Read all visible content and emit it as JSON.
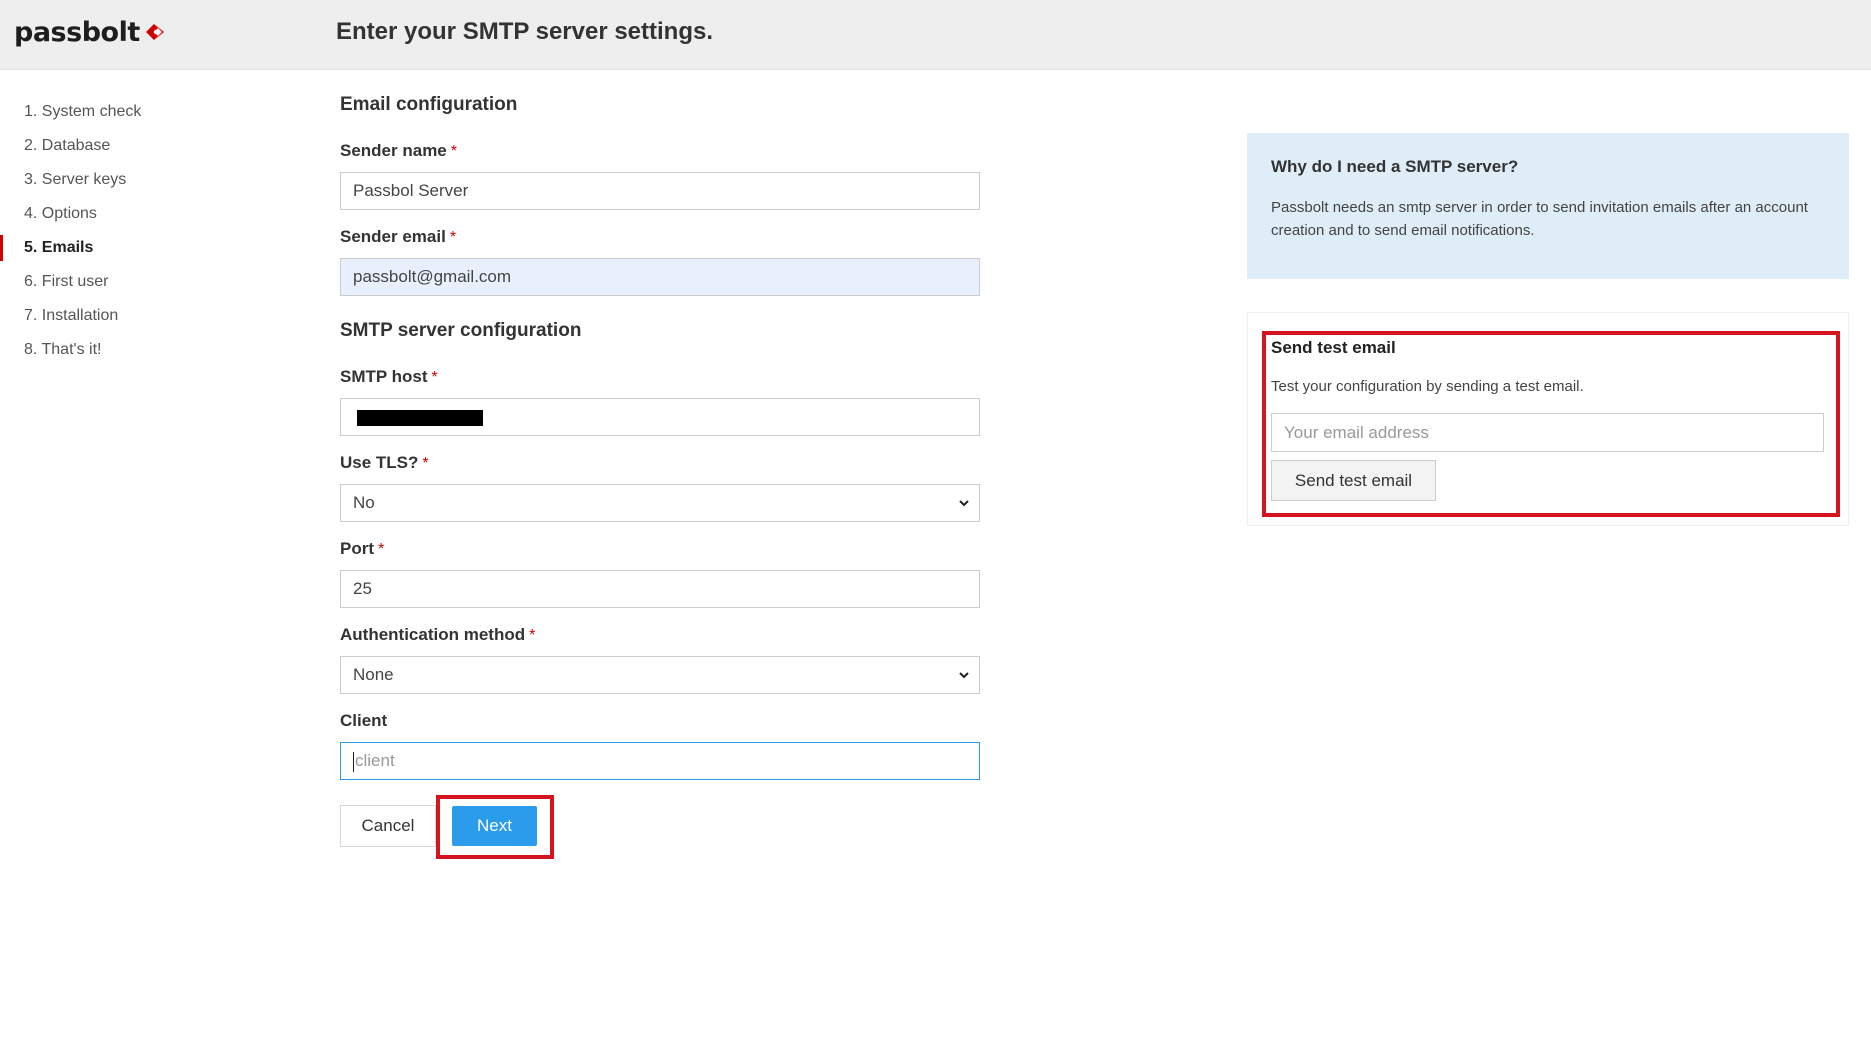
{
  "header": {
    "logo_text": "passbolt",
    "title": "Enter your SMTP server settings."
  },
  "sidebar": {
    "steps": [
      {
        "label": "1. System check",
        "active": false
      },
      {
        "label": "2. Database",
        "active": false
      },
      {
        "label": "3. Server keys",
        "active": false
      },
      {
        "label": "4. Options",
        "active": false
      },
      {
        "label": "5. Emails",
        "active": true
      },
      {
        "label": "6. First user",
        "active": false
      },
      {
        "label": "7. Installation",
        "active": false
      },
      {
        "label": "8. That's it!",
        "active": false
      }
    ]
  },
  "form": {
    "email_section_title": "Email configuration",
    "sender_name": {
      "label": "Sender name",
      "required": "*",
      "value": "Passbol Server"
    },
    "sender_email": {
      "label": "Sender email",
      "required": "*",
      "value": "passbolt@gmail.com"
    },
    "smtp_section_title": "SMTP server configuration",
    "smtp_host": {
      "label": "SMTP host",
      "required": "*"
    },
    "use_tls": {
      "label": "Use TLS?",
      "required": "*",
      "value": "No"
    },
    "port": {
      "label": "Port",
      "required": "*",
      "value": "25"
    },
    "auth_method": {
      "label": "Authentication method",
      "required": "*",
      "value": "None"
    },
    "client": {
      "label": "Client",
      "placeholder": "client"
    },
    "cancel_label": "Cancel",
    "next_label": "Next"
  },
  "info": {
    "title": "Why do I need a SMTP server?",
    "text": "Passbolt needs an smtp server in order to send invitation emails after an account creation and to send email notifications."
  },
  "test_email": {
    "title": "Send test email",
    "description": "Test your configuration by sending a test email.",
    "placeholder": "Your email address",
    "button_label": "Send test email"
  },
  "colors": {
    "brand_red": "#d40101",
    "primary_blue": "#2a9ceb",
    "highlight_red": "#d5141f",
    "info_background": "#deedf8"
  }
}
